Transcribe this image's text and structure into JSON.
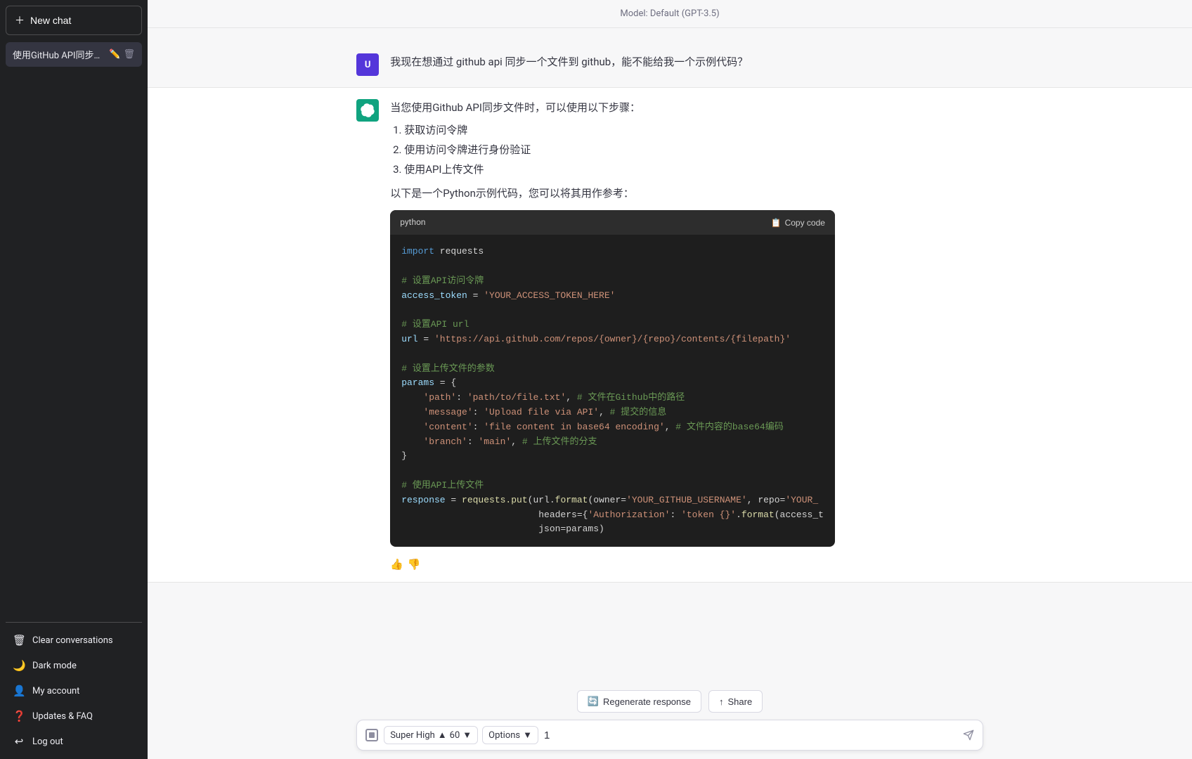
{
  "sidebar": {
    "new_chat_label": "New chat",
    "chat_items": [
      {
        "id": "chat-1",
        "label": "使用GitHub API同步文...",
        "active": true
      }
    ],
    "bottom_items": [
      {
        "id": "clear",
        "icon": "🗑",
        "label": "Clear conversations"
      },
      {
        "id": "dark",
        "icon": "🌙",
        "label": "Dark mode"
      },
      {
        "id": "account",
        "icon": "👤",
        "label": "My account"
      },
      {
        "id": "updates",
        "icon": "❓",
        "label": "Updates & FAQ"
      },
      {
        "id": "logout",
        "icon": "↩",
        "label": "Log out"
      }
    ]
  },
  "main": {
    "model_label": "Model: Default (GPT-3.5)",
    "messages": [
      {
        "role": "user",
        "avatar": "U",
        "text": "我现在想通过 github api 同步一个文件到 github，能不能给我一个示例代码？"
      },
      {
        "role": "assistant",
        "avatar": "GPT",
        "intro": "当您使用Github API同步文件时，可以使用以下步骤：",
        "steps": [
          "获取访问令牌",
          "使用访问令牌进行身份验证",
          "使用API上传文件"
        ],
        "code_intro": "以下是一个Python示例代码，您可以将其用作参考：",
        "code_lang": "python",
        "code_copy_label": "Copy code",
        "code_lines": [
          {
            "type": "normal",
            "text": "import requests",
            "parts": [
              {
                "t": "keyword",
                "v": "import"
              },
              {
                "t": "normal",
                "v": " requests"
              }
            ]
          },
          {
            "type": "blank"
          },
          {
            "type": "comment",
            "text": "# 设置API访问令牌"
          },
          {
            "type": "assignment",
            "var": "access_token",
            "val": "'YOUR_ACCESS_TOKEN_HERE'"
          },
          {
            "type": "blank"
          },
          {
            "type": "comment",
            "text": "# 设置API url"
          },
          {
            "type": "assignment",
            "var": "url",
            "val": "'https://api.github.com/repos/{owner}/{repo}/contents/{filepath}'"
          },
          {
            "type": "blank"
          },
          {
            "type": "comment",
            "text": "# 设置上传文件的参数"
          },
          {
            "type": "dict_start",
            "var": "params"
          },
          {
            "type": "dict_item",
            "key": "'path'",
            "val": "'path/to/file.txt'",
            "comment": "# 文件在Github中的路径"
          },
          {
            "type": "dict_item",
            "key": "'message'",
            "val": "'Upload file via API'",
            "comment": "# 提交的信息"
          },
          {
            "type": "dict_item",
            "key": "'content'",
            "val": "'file content in base64 encoding'",
            "comment": "# 文件内容的base64编码"
          },
          {
            "type": "dict_item",
            "key": "'branch'",
            "val": "'main'",
            "comment": "# 上传文件的分支"
          },
          {
            "type": "dict_end"
          },
          {
            "type": "blank"
          },
          {
            "type": "comment",
            "text": "# 使用API上传文件"
          },
          {
            "type": "call",
            "text": "response = requests.put(url.format(owner='YOUR_GITHUB_USERNAME', repo='YOUR_"
          },
          {
            "type": "continuation",
            "text": "                         headers={'Authorization': 'token {}'.format(access_t"
          },
          {
            "type": "continuation",
            "text": "                         json=params)"
          }
        ]
      }
    ],
    "action_bar": {
      "regenerate_label": "Regenerate response",
      "share_label": "Share"
    },
    "input": {
      "stop_title": "Stop",
      "quality": "Super High",
      "quality_num": 60,
      "options_label": "Options",
      "input_value": "1",
      "send_title": "Send"
    }
  }
}
